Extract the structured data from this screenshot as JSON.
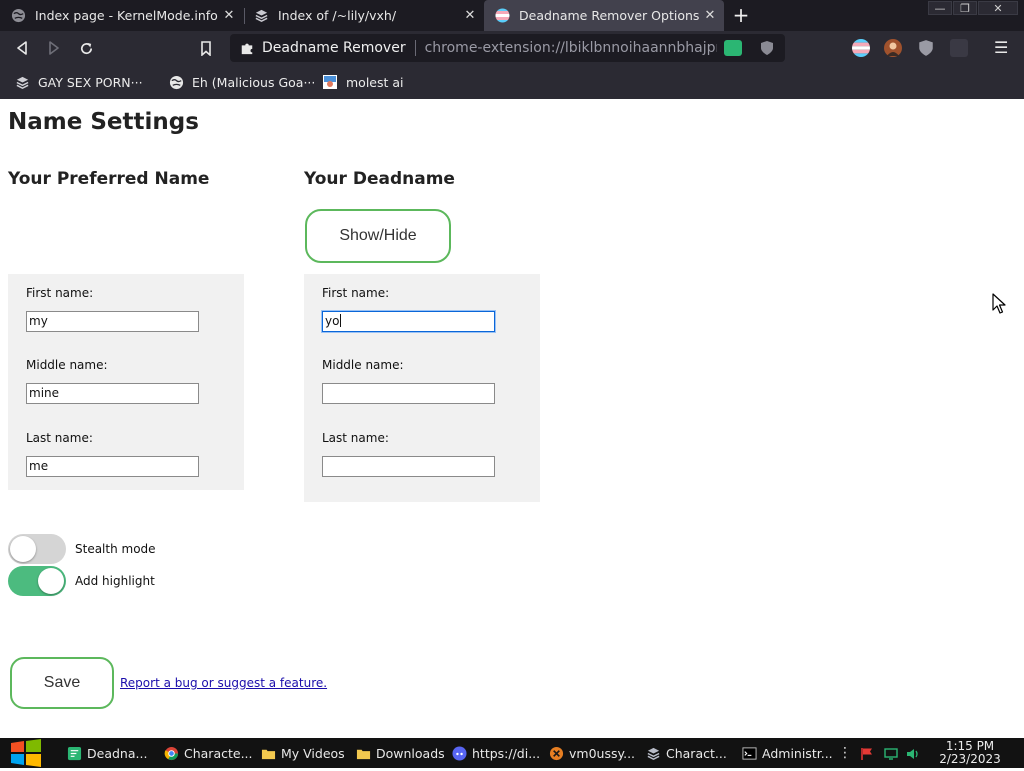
{
  "browser": {
    "tabs": [
      {
        "title": "Index page - KernelMode.info",
        "icon": "globe-icon",
        "active": false
      },
      {
        "title": "Index of /~lily/vxh/",
        "icon": "stack-icon",
        "active": false
      },
      {
        "title": "Deadname Remover Options",
        "icon": "trans-flag-icon",
        "active": true
      }
    ],
    "new_tab_label": "+",
    "window_controls": {
      "minimize": "—",
      "restore": "❐",
      "close": "✕"
    },
    "urlbar": {
      "extension_name": "Deadname Remover",
      "url": "chrome-extension://lbiklbnnoihaannbhajpmp···"
    },
    "bookmarks": [
      {
        "label": "GAY SEX PORN···",
        "icon": "stack-icon"
      },
      {
        "label": "Eh (Malicious Goa···",
        "icon": "globe-icon"
      },
      {
        "label": "molest ai",
        "icon": "image-icon"
      }
    ]
  },
  "page": {
    "title": "Name Settings",
    "preferred": {
      "heading": "Your Preferred Name",
      "first_label": "First name:",
      "first_value": "my",
      "middle_label": "Middle name:",
      "middle_value": "mine",
      "last_label": "Last name:",
      "last_value": "me"
    },
    "deadname": {
      "heading": "Your Deadname",
      "showhide_label": "Show/Hide",
      "first_label": "First name:",
      "first_value": "yo",
      "middle_label": "Middle name:",
      "middle_value": "",
      "last_label": "Last name:",
      "last_value": ""
    },
    "toggles": [
      {
        "label": "Stealth mode",
        "on": false
      },
      {
        "label": "Add highlight",
        "on": true
      }
    ],
    "save_label": "Save",
    "report_link": "Report a bug or suggest a feature."
  },
  "taskbar": {
    "tasks": [
      {
        "label": "Deadna...",
        "icon": "green-chat-icon"
      },
      {
        "label": "Characte...",
        "icon": "chrome-icon"
      },
      {
        "label": "My Videos",
        "icon": "folder-icon"
      },
      {
        "label": "Downloads",
        "icon": "folder-icon"
      },
      {
        "label": "https://di...",
        "icon": "discord-icon"
      },
      {
        "label": "vm0ussy...",
        "icon": "x-circle-icon"
      },
      {
        "label": "Charact...",
        "icon": "stack-icon"
      },
      {
        "label": "Administr...",
        "icon": "cmd-icon"
      }
    ],
    "time": "1:15 PM",
    "date": "2/23/2023"
  },
  "colors": {
    "accent_green": "#5cb85c",
    "toggle_on": "#4cbb7f",
    "toggle_off": "#d5d5d5",
    "panel_bg": "#f1f1f1",
    "chrome_dark": "#1c1b22",
    "chrome_mid": "#2b2a33",
    "link": "#1a0dab"
  }
}
